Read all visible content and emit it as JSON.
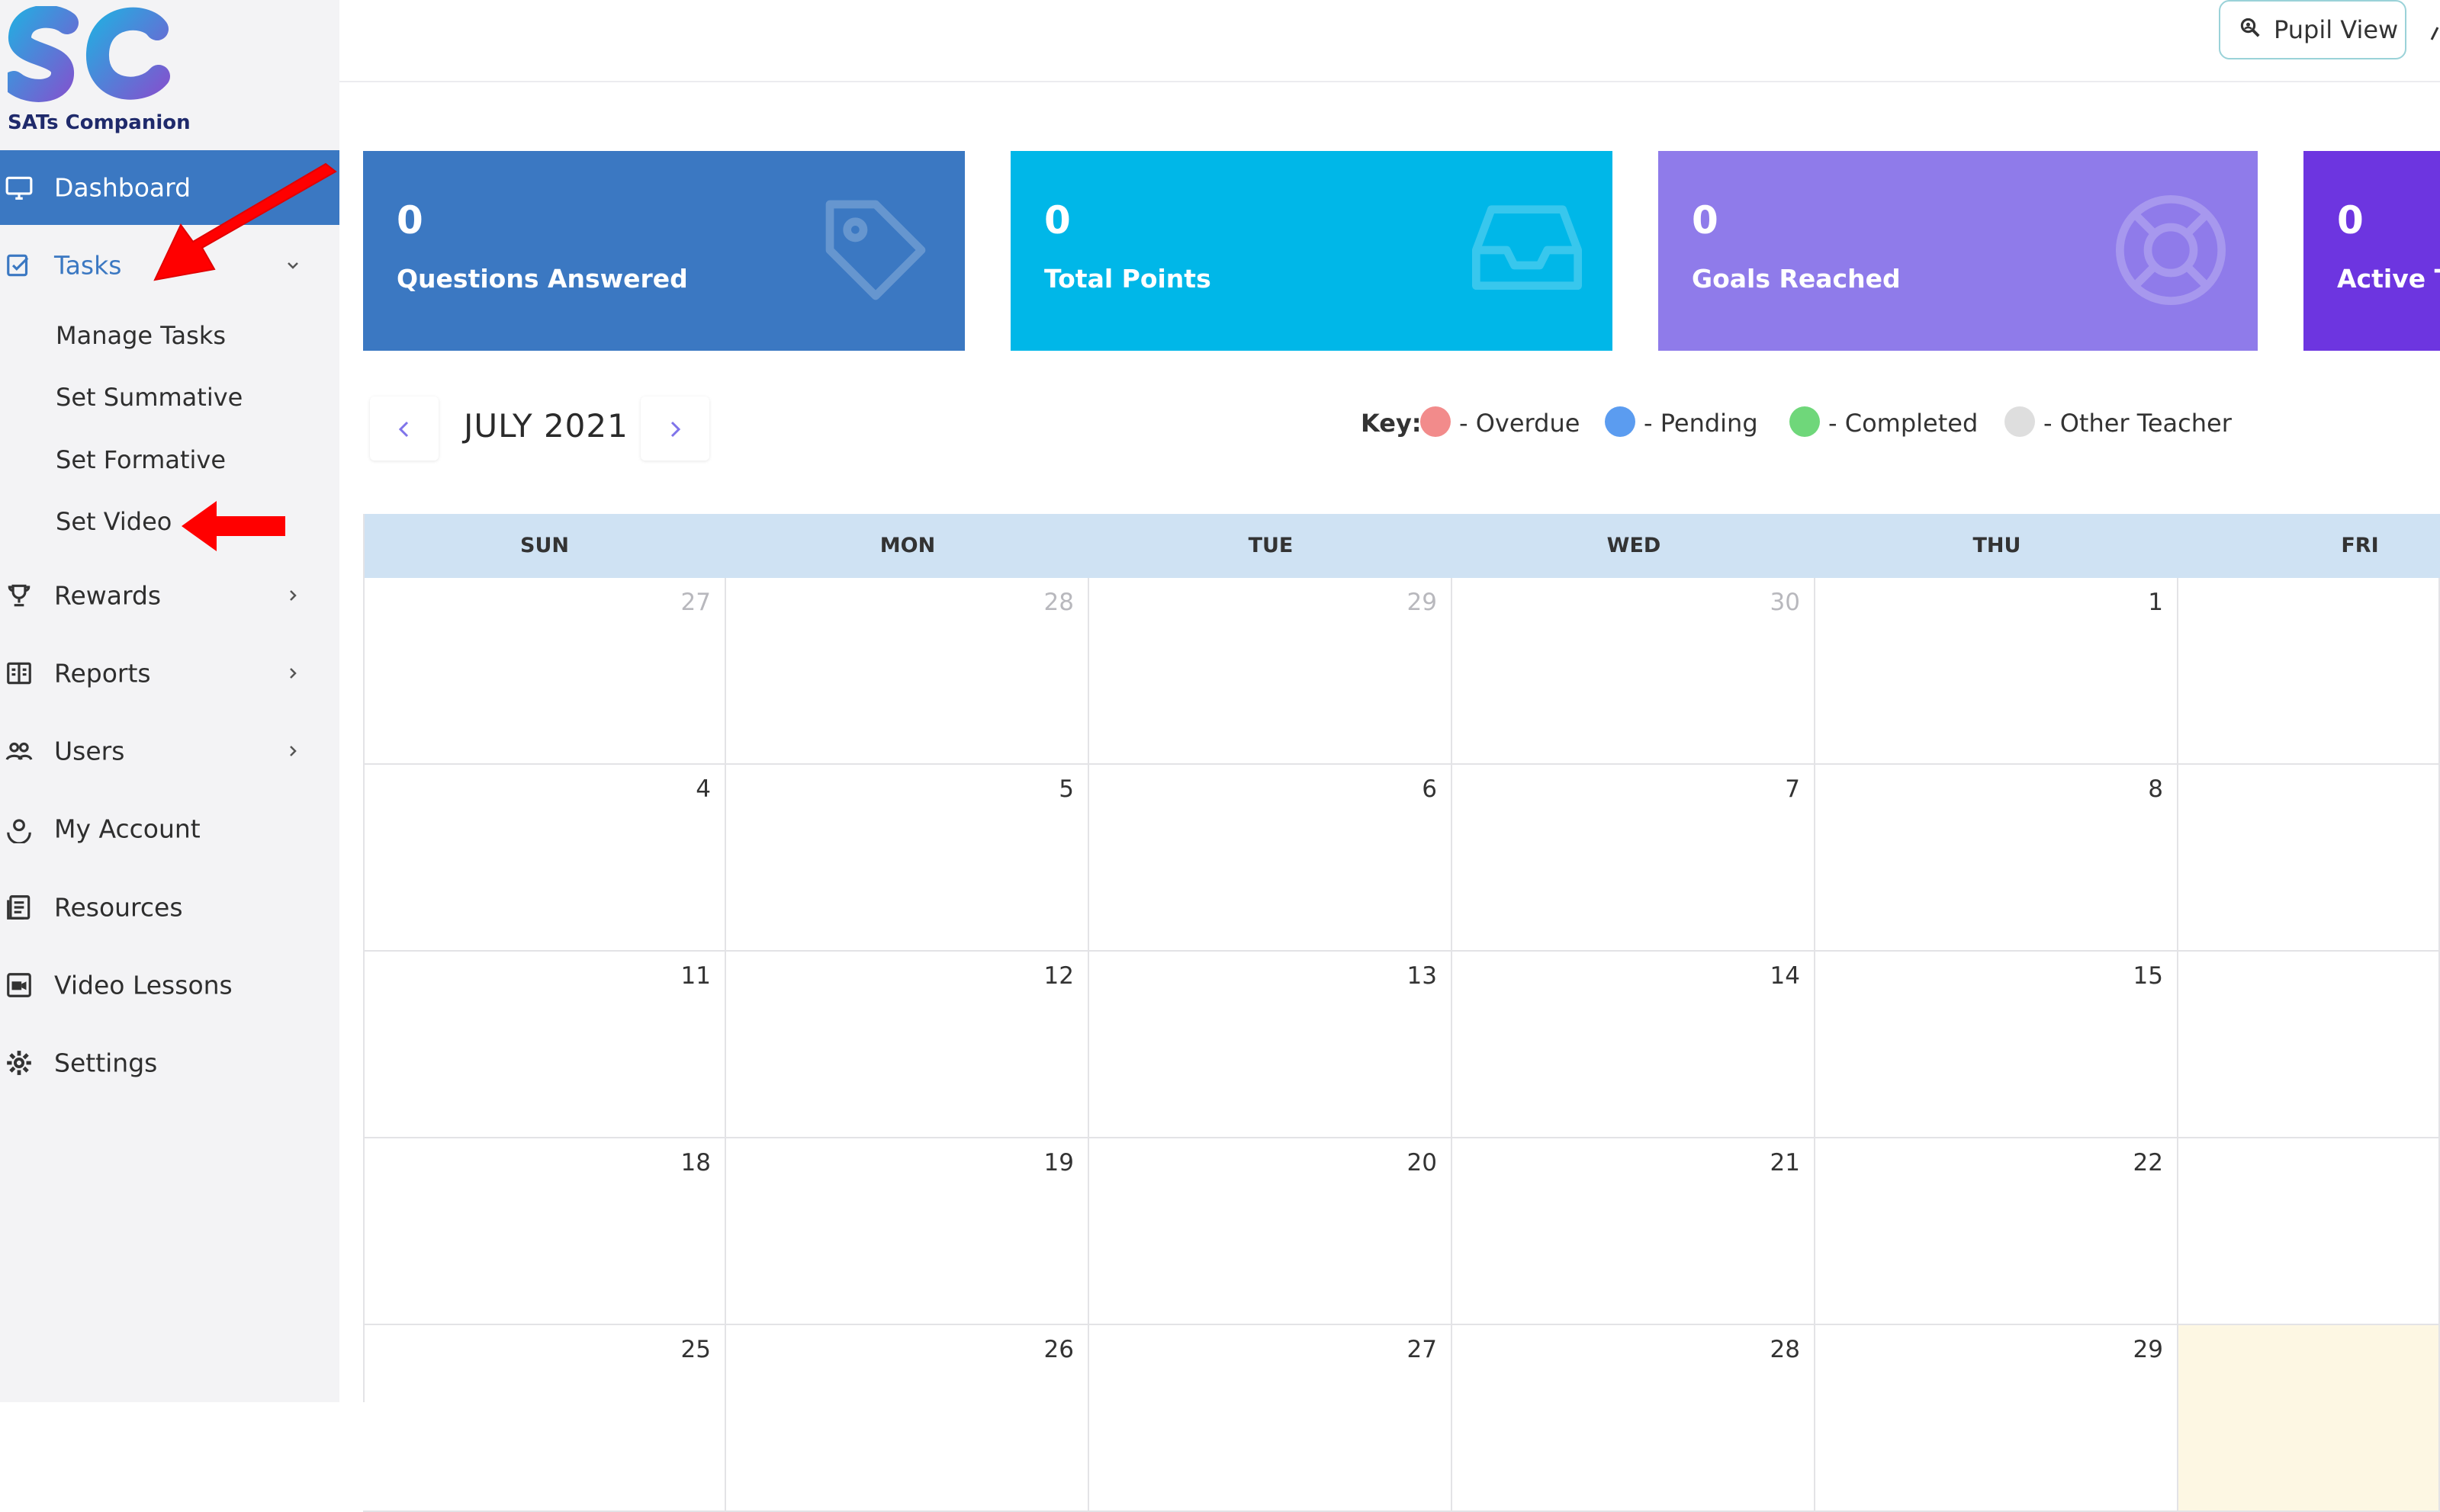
{
  "brand": {
    "logo_text": "SATs Companion",
    "accent": "#3b78c2"
  },
  "topbar": {
    "pupil_view_label": "Pupil View"
  },
  "sidebar": {
    "items": [
      {
        "label": "Dashboard",
        "icon": "monitor-icon",
        "active": true
      },
      {
        "label": "Tasks",
        "icon": "task-check-icon",
        "chevron": "down"
      },
      {
        "label": "Rewards",
        "icon": "trophy-icon",
        "chevron": "right"
      },
      {
        "label": "Reports",
        "icon": "report-icon",
        "chevron": "right"
      },
      {
        "label": "Users",
        "icon": "users-icon",
        "chevron": "right"
      },
      {
        "label": "My Account",
        "icon": "account-icon"
      },
      {
        "label": "Resources",
        "icon": "resources-icon"
      },
      {
        "label": "Video Lessons",
        "icon": "video-icon"
      },
      {
        "label": "Settings",
        "icon": "gear-icon"
      }
    ],
    "task_subitems": [
      "Manage Tasks",
      "Set Summative",
      "Set Formative",
      "Set Video"
    ]
  },
  "stats": [
    {
      "value": "0",
      "label": "Questions Answered",
      "color": "#3b78c2",
      "icon": "tag-icon"
    },
    {
      "value": "0",
      "label": "Total Points",
      "color": "#00b7e8",
      "icon": "inbox-icon"
    },
    {
      "value": "0",
      "label": "Goals Reached",
      "color": "#8f7bea",
      "icon": "lifebuoy-icon"
    },
    {
      "value": "0",
      "label": "Active T",
      "color": "#6d35e0",
      "icon": ""
    }
  ],
  "calendar": {
    "month_label": "JULY 2021",
    "key_label": "Key:",
    "key": [
      {
        "label": "- Overdue",
        "color": "#f28b8b"
      },
      {
        "label": "- Pending",
        "color": "#5b9cf0"
      },
      {
        "label": "- Completed",
        "color": "#6fd77a"
      },
      {
        "label": "- Other Teacher",
        "color": "#dedede"
      }
    ],
    "weekdays": [
      "SUN",
      "MON",
      "TUE",
      "WED",
      "THU",
      "FRI"
    ],
    "weeks": [
      [
        "27",
        "28",
        "29",
        "30",
        "1",
        ""
      ],
      [
        "4",
        "5",
        "6",
        "7",
        "8",
        ""
      ],
      [
        "11",
        "12",
        "13",
        "14",
        "15",
        ""
      ],
      [
        "18",
        "19",
        "20",
        "21",
        "22",
        ""
      ],
      [
        "25",
        "26",
        "27",
        "28",
        "29",
        ""
      ]
    ],
    "other_month": [
      [
        true,
        true,
        true,
        true,
        false,
        false
      ],
      [
        false,
        false,
        false,
        false,
        false,
        false
      ],
      [
        false,
        false,
        false,
        false,
        false,
        false
      ],
      [
        false,
        false,
        false,
        false,
        false,
        false
      ],
      [
        false,
        false,
        false,
        false,
        false,
        false
      ]
    ],
    "today": {
      "week": 4,
      "day": 5
    }
  },
  "annotations": {
    "arrow_color": "#ff0000"
  }
}
